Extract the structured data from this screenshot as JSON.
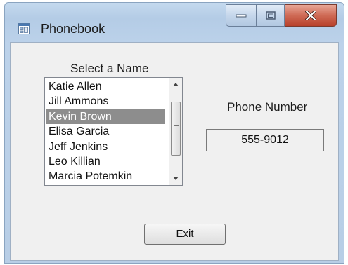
{
  "window": {
    "title": "Phonebook",
    "title_icon": "form-icon",
    "controls": {
      "minimize_icon": "minimize-icon",
      "maximize_icon": "maximize-icon",
      "close_icon": "close-icon"
    }
  },
  "form": {
    "select_label": "Select a Name",
    "names": [
      "Katie Allen",
      "Jill Ammons",
      "Kevin Brown",
      "Elisa Garcia",
      "Jeff Jenkins",
      "Leo Killian",
      "Marcia Potemkin"
    ],
    "selected_name": "Kevin Brown",
    "phone_label": "Phone Number",
    "phone_value": "555-9012",
    "exit_label": "Exit"
  }
}
